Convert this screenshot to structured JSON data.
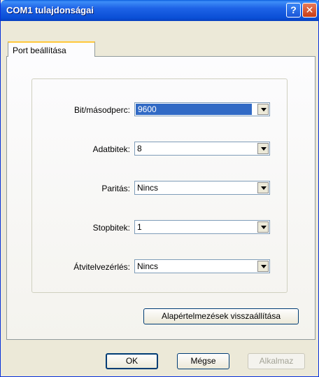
{
  "window": {
    "title": "COM1 tulajdonságai"
  },
  "titlebar": {
    "help_glyph": "?",
    "close_glyph": "✕"
  },
  "tabs": [
    {
      "label": "Port beállítása",
      "active": true
    }
  ],
  "fields": [
    {
      "label": "Bit/másodperc:",
      "value": "9600",
      "selected": true
    },
    {
      "label": "Adatbitek:",
      "value": "8"
    },
    {
      "label": "Paritás:",
      "value": "Nincs"
    },
    {
      "label": "Stopbitek:",
      "value": "1"
    },
    {
      "label": "Átvitelvezérlés:",
      "value": "Nincs"
    }
  ],
  "restore_defaults_label": "Alapértelmezések visszaállítása",
  "buttons": {
    "ok": "OK",
    "cancel": "Mégse",
    "apply": "Alkalmaz"
  },
  "colors": {
    "title_bar": "#0a4fd6",
    "selection": "#316ac5",
    "dialog_face": "#ece9d8"
  }
}
